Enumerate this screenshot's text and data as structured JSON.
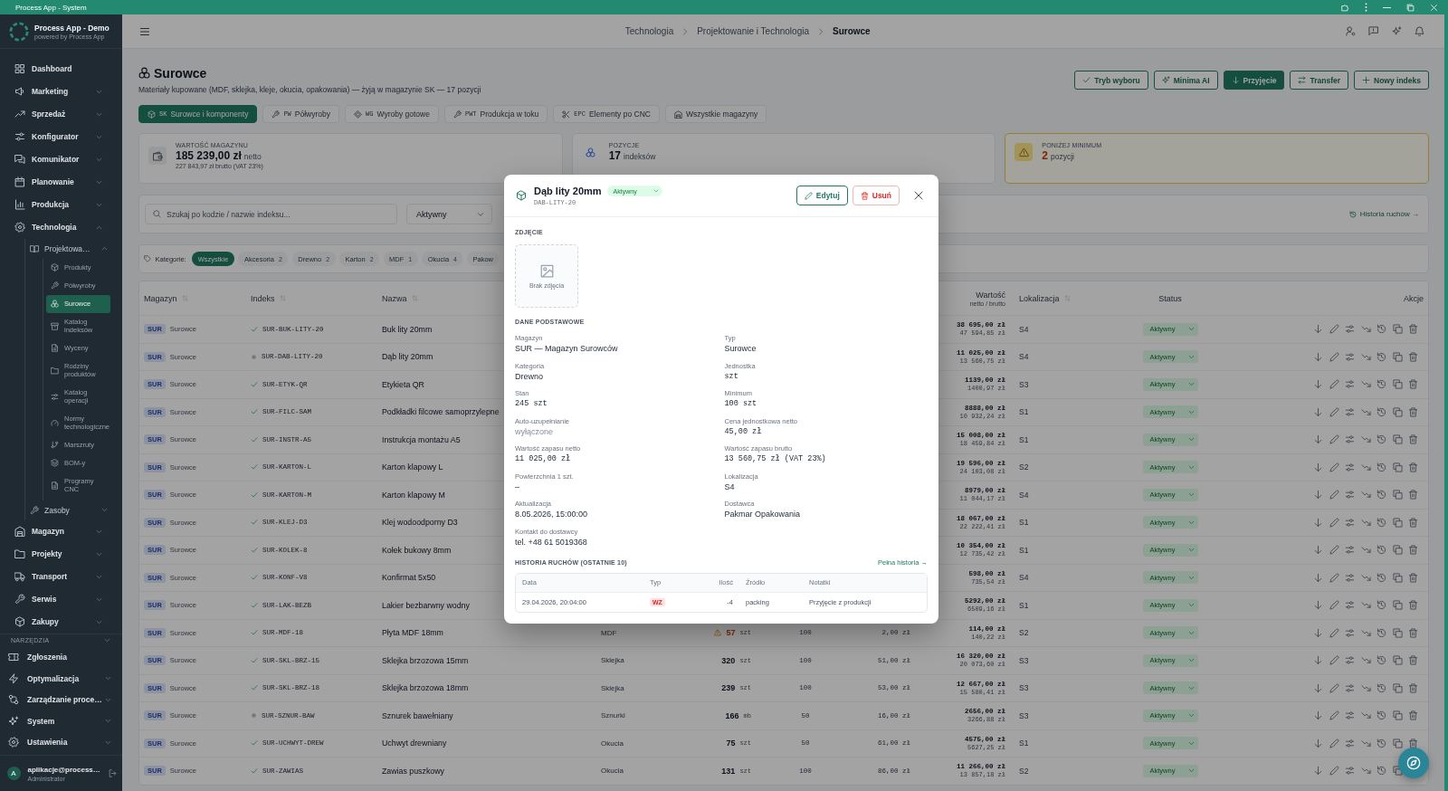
{
  "window": {
    "title": "Process App - System"
  },
  "sidebar": {
    "app_name": "Process App - Demo",
    "app_tagline": "powered by Process App",
    "items": [
      {
        "kind": "link",
        "label": "Dashboard",
        "selected": false
      },
      {
        "kind": "group",
        "label": "Marketing",
        "expanded": false
      },
      {
        "kind": "group",
        "label": "Sprzedaż",
        "expanded": false
      },
      {
        "kind": "group",
        "label": "Konfigurator",
        "expanded": false
      },
      {
        "kind": "group",
        "label": "Komunikator",
        "expanded": false
      },
      {
        "kind": "group",
        "label": "Planowanie",
        "expanded": false
      },
      {
        "kind": "group",
        "label": "Produkcja",
        "expanded": false
      },
      {
        "kind": "group",
        "label": "Technologia",
        "expanded": true,
        "children": [
          {
            "kind": "group",
            "label": "Projektowa…",
            "expanded": true,
            "children": [
              {
                "kind": "link",
                "label": "Produkty",
                "selected": false
              },
              {
                "kind": "link",
                "label": "Półwyroby",
                "selected": false
              },
              {
                "kind": "link",
                "label": "Surowce",
                "selected": true
              },
              {
                "kind": "link",
                "label": "Katalog indeksów",
                "selected": false
              },
              {
                "kind": "link",
                "label": "Wyceny",
                "selected": false
              },
              {
                "kind": "link",
                "label": "Rodziny produktów",
                "selected": false
              },
              {
                "kind": "link",
                "label": "Katalog operacji",
                "selected": false
              },
              {
                "kind": "link",
                "label": "Normy technologiczne",
                "selected": false
              },
              {
                "kind": "link",
                "label": "Marszruty",
                "selected": false
              },
              {
                "kind": "link",
                "label": "BOM-y",
                "selected": false
              },
              {
                "kind": "link",
                "label": "Programy CNC",
                "selected": false
              }
            ]
          },
          {
            "kind": "group",
            "label": "Zasoby",
            "expanded": false
          }
        ]
      },
      {
        "kind": "group",
        "label": "Magazyn",
        "expanded": false
      },
      {
        "kind": "group",
        "label": "Projekty",
        "expanded": false
      },
      {
        "kind": "group",
        "label": "Transport",
        "expanded": false
      },
      {
        "kind": "group",
        "label": "Serwis",
        "expanded": false
      },
      {
        "kind": "group",
        "label": "Zakupy",
        "expanded": false
      }
    ],
    "tools": {
      "title": "NARZĘDZIA",
      "items": [
        {
          "kind": "link",
          "label": "Zgłoszenia",
          "selected": false
        },
        {
          "kind": "group",
          "label": "Optymalizacja",
          "expanded": false
        },
        {
          "kind": "group",
          "label": "Zarządzanie proce…",
          "expanded": false
        },
        {
          "kind": "group",
          "label": "System",
          "expanded": false
        },
        {
          "kind": "group",
          "label": "Ustawienia",
          "expanded": false
        }
      ]
    },
    "user": {
      "initial": "A",
      "name": "aplikacje@process…",
      "role": "Administrator"
    }
  },
  "header": {
    "breadcrumbs": [
      {
        "label": "Technologia",
        "current": false
      },
      {
        "label": "Projektowanie i Technologia",
        "current": false
      },
      {
        "label": "Surowce",
        "current": true
      }
    ]
  },
  "page": {
    "title": "Surowce",
    "subtitle": "Materiały kupowane (MDF, sklejka, kleje, okucia, opakowania) — żyją w magazynie SK — 17 pozycji",
    "actions": [
      {
        "label": "Tryb wyboru",
        "primary": false
      },
      {
        "label": "Minima AI",
        "primary": false
      },
      {
        "label": "Przyjęcie",
        "primary": true
      },
      {
        "label": "Transfer",
        "primary": false
      },
      {
        "label": "Nowy indeks",
        "primary": false
      }
    ]
  },
  "warehouse_tabs": [
    {
      "code": "SK",
      "label": "Surowce i komponenty",
      "selected": true
    },
    {
      "code": "PW",
      "label": "Półwyroby",
      "selected": false
    },
    {
      "code": "WG",
      "label": "Wyroby gotowe",
      "selected": false
    },
    {
      "code": "PWT",
      "label": "Produkcja w toku",
      "selected": false
    },
    {
      "code": "EPC",
      "label": "Elementy po CNC",
      "selected": false
    },
    {
      "label": "Wszystkie magazyny",
      "selected": false
    }
  ],
  "stats": [
    {
      "kind": "value",
      "label": "WARTOŚĆ MAGAZYNU",
      "value": "185 239,00 zł",
      "unit": "netto",
      "note": "227 843,97 zł brutto (VAT 23%)"
    },
    {
      "kind": "count",
      "label": "POZYCJE",
      "value": "17",
      "unit": "indeksów"
    },
    {
      "kind": "warning",
      "label": "PONIŻEJ MINIMUM",
      "value": "2",
      "unit": "pozycji"
    }
  ],
  "filters": {
    "search": {
      "placeholder": "Szukaj po kodzie / nazwie indeksu..."
    },
    "status": {
      "value": "Aktywny"
    },
    "history_link": "Historia ruchów →"
  },
  "categories": {
    "label": "Kategorie:",
    "chips": [
      {
        "label": "Wszystkie",
        "selected": true
      },
      {
        "label": "Akcesoria",
        "count": "2",
        "selected": false
      },
      {
        "label": "Drewno",
        "count": "2",
        "selected": false
      },
      {
        "label": "Karton",
        "count": "2",
        "selected": false
      },
      {
        "label": "MDF",
        "count": "1",
        "selected": false
      },
      {
        "label": "Okucia",
        "count": "4",
        "selected": false
      },
      {
        "label": "Pakow",
        "selected": false
      }
    ]
  },
  "table": {
    "columns": [
      {
        "label": "Magazyn",
        "sortable": true
      },
      {
        "label": "Indeks",
        "sortable": true
      },
      {
        "label": "Nazwa",
        "sortable": true
      },
      {
        "label": "Wartość",
        "sublabel": "netto / brutto",
        "sortable": false
      },
      {
        "label": "Lokalizacja",
        "sortable": true
      },
      {
        "label": "Status",
        "sortable": false
      },
      {
        "label": "Akcje",
        "sortable": false
      }
    ],
    "rows": [
      {
        "warehouse_code": "SUR",
        "warehouse": "Surowce",
        "verified": true,
        "index": "SUR-BUK-LITY-20",
        "name": "Buk lity 20mm",
        "value_net": "38 695,00 zł",
        "value_gross": "47 594,85 zł",
        "location": "S4",
        "status": "Aktywny"
      },
      {
        "warehouse_code": "SUR",
        "warehouse": "Surowce",
        "verified": false,
        "index": "SUR-DAB-LITY-20",
        "name": "Dąb lity 20mm",
        "value_net": "11 025,00 zł",
        "value_gross": "13 560,75 zł",
        "location": "S4",
        "status": "Aktywny"
      },
      {
        "warehouse_code": "SUR",
        "warehouse": "Surowce",
        "verified": true,
        "index": "SUR-ETYK-QR",
        "name": "Etykieta QR",
        "value_net": "1139,00 zł",
        "value_gross": "1400,97 zł",
        "location": "S3",
        "status": "Aktywny"
      },
      {
        "warehouse_code": "SUR",
        "warehouse": "Surowce",
        "verified": true,
        "index": "SUR-FILC-SAM",
        "name": "Podkładki filcowe samoprzylepne",
        "value_net": "8888,00 zł",
        "value_gross": "10 932,24 zł",
        "location": "S1",
        "status": "Aktywny"
      },
      {
        "warehouse_code": "SUR",
        "warehouse": "Surowce",
        "verified": true,
        "index": "SUR-INSTR-A5",
        "name": "Instrukcja montażu A5",
        "value_net": "15 008,00 zł",
        "value_gross": "18 459,84 zł",
        "location": "S1",
        "status": "Aktywny"
      },
      {
        "warehouse_code": "SUR",
        "warehouse": "Surowce",
        "verified": true,
        "index": "SUR-KARTON-L",
        "name": "Karton klapowy L",
        "value_net": "19 596,00 zł",
        "value_gross": "24 103,08 zł",
        "location": "S2",
        "status": "Aktywny"
      },
      {
        "warehouse_code": "SUR",
        "warehouse": "Surowce",
        "verified": true,
        "index": "SUR-KARTON-M",
        "name": "Karton klapowy M",
        "value_net": "8979,00 zł",
        "value_gross": "11 044,17 zł",
        "location": "S4",
        "status": "Aktywny"
      },
      {
        "warehouse_code": "SUR",
        "warehouse": "Surowce",
        "verified": true,
        "index": "SUR-KLEJ-D3",
        "name": "Klej wodoodporny D3",
        "value_net": "18 067,00 zł",
        "value_gross": "22 222,41 zł",
        "location": "S1",
        "status": "Aktywny"
      },
      {
        "warehouse_code": "SUR",
        "warehouse": "Surowce",
        "verified": true,
        "index": "SUR-KOLEK-8",
        "name": "Kołek bukowy 8mm",
        "value_net": "10 354,00 zł",
        "value_gross": "12 735,42 zł",
        "location": "S1",
        "status": "Aktywny"
      },
      {
        "warehouse_code": "SUR",
        "warehouse": "Surowce",
        "verified": true,
        "index": "SUR-KONF-V8",
        "name": "Konfirmat 5x50",
        "value_net": "598,00 zł",
        "value_gross": "735,54 zł",
        "location": "S4",
        "status": "Aktywny"
      },
      {
        "warehouse_code": "SUR",
        "warehouse": "Surowce",
        "verified": true,
        "index": "SUR-LAK-BEZB",
        "name": "Lakier bezbarwny wodny",
        "value_net": "5292,00 zł",
        "value_gross": "6509,16 zł",
        "location": "S1",
        "status": "Aktywny"
      },
      {
        "warehouse_code": "SUR",
        "warehouse": "Surowce",
        "verified": true,
        "index": "SUR-MDF-18",
        "name": "Płyta MDF 18mm",
        "column_4": "MDF",
        "column_5": {
          "value": "57",
          "unit": "szt",
          "below_minimum": true
        },
        "column_6": "100",
        "column_7": "2,00 zł",
        "value_net": "114,00 zł",
        "value_gross": "140,22 zł",
        "location": "S2",
        "status": "Aktywny"
      },
      {
        "warehouse_code": "SUR",
        "warehouse": "Surowce",
        "verified": true,
        "index": "SUR-SKL-BRZ-15",
        "name": "Sklejka brzozowa 15mm",
        "column_4": "Sklejka",
        "column_5": {
          "value": "320",
          "unit": "szt",
          "below_minimum": false
        },
        "column_6": "100",
        "column_7": "51,00 zł",
        "value_net": "16 320,00 zł",
        "value_gross": "20 073,60 zł",
        "location": "S3",
        "status": "Aktywny"
      },
      {
        "warehouse_code": "SUR",
        "warehouse": "Surowce",
        "verified": true,
        "index": "SUR-SKL-BRZ-18",
        "name": "Sklejka brzozowa 18mm",
        "column_4": "Sklejka",
        "column_5": {
          "value": "239",
          "unit": "szt",
          "below_minimum": false
        },
        "column_6": "100",
        "column_7": "53,00 zł",
        "value_net": "12 667,00 zł",
        "value_gross": "15 580,41 zł",
        "location": "S3",
        "status": "Aktywny"
      },
      {
        "warehouse_code": "SUR",
        "warehouse": "Surowce",
        "verified": false,
        "index": "SUR-SZNUR-BAW",
        "name": "Sznurek bawełniany",
        "column_4": "Sznurki",
        "column_5": {
          "value": "166",
          "unit": "mb",
          "below_minimum": false
        },
        "column_6": "50",
        "column_7": "16,00 zł",
        "value_net": "2656,00 zł",
        "value_gross": "3266,88 zł",
        "location": "S3",
        "status": "Aktywny"
      },
      {
        "warehouse_code": "SUR",
        "warehouse": "Surowce",
        "verified": true,
        "index": "SUR-UCHWYT-DREW",
        "name": "Uchwyt drewniany",
        "column_4": "Okucia",
        "column_5": {
          "value": "75",
          "unit": "szt",
          "below_minimum": false
        },
        "column_6": "50",
        "column_7": "61,00 zł",
        "value_net": "4575,00 zł",
        "value_gross": "5627,25 zł",
        "location": "S1",
        "status": "Aktywny"
      },
      {
        "warehouse_code": "SUR",
        "warehouse": "Surowce",
        "verified": true,
        "index": "SUR-ZAWIAS",
        "name": "Zawias puszkowy",
        "column_4": "Okucia",
        "column_5": {
          "value": "131",
          "unit": "szt",
          "below_minimum": false
        },
        "column_6": "100",
        "column_7": "86,00 zł",
        "value_net": "11 266,00 zł",
        "value_gross": "13 857,18 zł",
        "location": "S2",
        "status": "Aktywny"
      }
    ]
  },
  "detail_modal": {
    "title": "Dąb lity 20mm",
    "status": "Aktywny",
    "code": "DAB-LITY-20",
    "actions": [
      {
        "label": "Edytuj",
        "kind": "edit"
      },
      {
        "label": "Usuń",
        "kind": "delete"
      }
    ],
    "photo": {
      "title": "ZDJĘCIE",
      "caption": "Brak zdjęcia"
    },
    "basic": {
      "title": "DANE PODSTAWOWE",
      "fields": [
        {
          "label": "Magazyn",
          "value": "SUR — Magazyn Surowców",
          "kind": "text"
        },
        {
          "label": "Typ",
          "value": "Surowce",
          "kind": "text"
        },
        {
          "label": "Kategoria",
          "value": "Drewno",
          "kind": "text"
        },
        {
          "label": "Jednostka",
          "value": "szt",
          "kind": "mono"
        },
        {
          "label": "Stan",
          "value": "245 szt",
          "kind": "mono"
        },
        {
          "label": "Minimum",
          "value": "100 szt",
          "kind": "mono"
        },
        {
          "label": "Auto-uzupełnianie",
          "value": "wyłączone",
          "kind": "muted"
        },
        {
          "label": "Cena jednostkowa netto",
          "value": "45,00 zł",
          "kind": "mono"
        },
        {
          "label": "Wartość zapasu netto",
          "value": "11 025,00 zł",
          "kind": "mono"
        },
        {
          "label": "Wartość zapasu brutto",
          "value": "13 560,75 zł (VAT 23%)",
          "kind": "mono"
        },
        {
          "label": "Powierzchnia 1 szt.",
          "value": "–",
          "kind": "text"
        },
        {
          "label": "Lokalizacja",
          "value": "S4",
          "kind": "text"
        },
        {
          "label": "Aktualizacja",
          "value": "8.05.2026, 15:00:00",
          "kind": "text"
        },
        {
          "label": "Dostawca",
          "value": "Pakmar Opakowania",
          "kind": "text"
        },
        {
          "label": "Kontakt do dostawcy",
          "value": "tel. +48 61 5019368",
          "kind": "text"
        }
      ]
    },
    "history": {
      "title": "HISTORIA RUCHÓW (OSTATNIE 10)",
      "link": "Pełna historia →",
      "columns": [
        "Data",
        "Typ",
        "Ilość",
        "Źródło",
        "Notatki"
      ],
      "rows": [
        {
          "date": "29.04.2026, 20:04:00",
          "type": "WZ",
          "kind": "outgoing",
          "quantity": "-4",
          "source": "packing",
          "notes": "Przyjęcie z produkcji"
        }
      ]
    }
  }
}
